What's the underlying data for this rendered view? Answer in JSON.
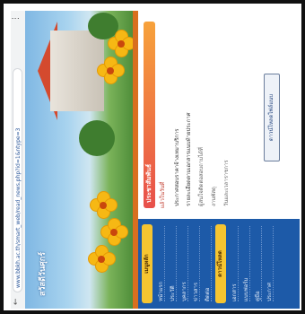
{
  "browser": {
    "url": "www.bbkh.ac.th/smart_web/read_news.php?id=1&ntype=3",
    "back_glyph": "←",
    "menu_glyph": "⋮"
  },
  "banner": {
    "title": "สวัสดีวันศุกร์"
  },
  "sidebar": {
    "header": "เมนูหลัก",
    "items": [
      "หน้าแรก",
      "ประวัติ",
      "บุคลากร",
      "ข่าวสาร",
      "ติดต่อ"
    ],
    "header2": "ดาวน์โหลด",
    "items2": [
      "เอกสาร",
      "แบบฟอร์ม",
      "คู่มือ",
      "ประกาศ"
    ]
  },
  "content": {
    "title": "ประชาสัมพันธ์",
    "date": "แล้วในวันที่",
    "lines": [
      "ประกาศสอบราคาจ้างเหมาบริการ",
      "รายละเอียดตามเอกสารแนบท้ายประกาศ",
      "ผู้สนใจติดต่อสอบถามได้ที่",
      "งานพัสดุ",
      "วันและเวลาราชการ"
    ],
    "download": "ดาวน์โหลดไฟล์แนบ"
  },
  "colors": {
    "accent": "#1d5aa8",
    "stripe": "#d86f1f",
    "flower": "#f6b814"
  }
}
